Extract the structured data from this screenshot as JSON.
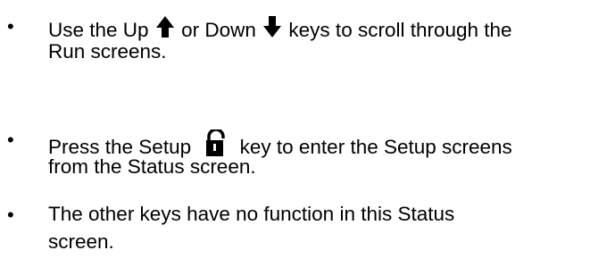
{
  "bullets": [
    {
      "line1_part1": "Use the Up",
      "icon1": "up-arrow-icon",
      "line1_part2": "or Down",
      "icon2": "down-arrow-icon",
      "line1_part3": "keys to scroll through the",
      "line2": "Run screens."
    },
    {
      "line1_part1": "Press the Setup",
      "icon1": "unlocked-padlock-icon",
      "line1_part2": "key to enter the Setup screens",
      "line2": "from the Status screen."
    },
    {
      "line1": "The other keys have no function in this Status",
      "line2": "screen."
    }
  ],
  "bullet_glyph": "•",
  "icon_color": "#000000"
}
